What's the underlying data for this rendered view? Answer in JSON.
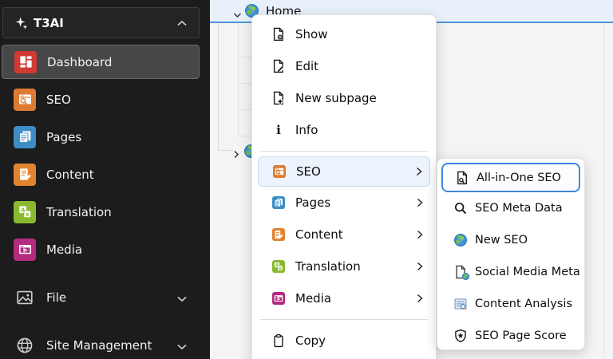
{
  "sidebar": {
    "header": {
      "label": "T3AI",
      "icon": "sparkles-icon",
      "state_icon": "chevron-up-icon"
    },
    "modules": [
      {
        "label": "Dashboard",
        "icon": "dashboard-icon",
        "color": "#d13a34",
        "active": true
      },
      {
        "label": "SEO",
        "icon": "seo-icon",
        "color": "#de7b32",
        "active": false
      },
      {
        "label": "Pages",
        "icon": "pages-icon",
        "color": "#3d8dc6",
        "active": false
      },
      {
        "label": "Content",
        "icon": "content-icon",
        "color": "#e1842f",
        "active": false
      },
      {
        "label": "Translation",
        "icon": "translation-icon",
        "color": "#8ab92f",
        "active": false
      },
      {
        "label": "Media",
        "icon": "media-icon",
        "color": "#b42b80",
        "active": false
      }
    ],
    "sections": [
      {
        "label": "File",
        "icon": "image-icon",
        "state_icon": "chevron-down-icon"
      },
      {
        "label": "Site Management",
        "icon": "globe-outline-icon",
        "state_icon": "chevron-down-icon"
      }
    ]
  },
  "page_tree": {
    "root_node": {
      "label": "Home",
      "icon": "globe-icon",
      "expanded": true,
      "selected": true
    }
  },
  "context_menu": {
    "items_top": [
      {
        "label": "Show",
        "icon": "view-page-icon"
      },
      {
        "label": "Edit",
        "icon": "edit-page-icon"
      },
      {
        "label": "New subpage",
        "icon": "new-page-icon"
      },
      {
        "label": "Info",
        "icon": "info-icon"
      }
    ],
    "module_items": [
      {
        "label": "SEO",
        "icon": "seo-icon",
        "color": "#de7b32",
        "highlighted": true
      },
      {
        "label": "Pages",
        "icon": "pages-icon",
        "color": "#3d8dc6",
        "highlighted": false
      },
      {
        "label": "Content",
        "icon": "content-icon",
        "color": "#e1842f",
        "highlighted": false
      },
      {
        "label": "Translation",
        "icon": "translation-icon",
        "color": "#8ab92f",
        "highlighted": false
      },
      {
        "label": "Media",
        "icon": "media-icon",
        "color": "#b42b80",
        "highlighted": false
      }
    ],
    "items_bottom": [
      {
        "label": "Copy",
        "icon": "clipboard-icon"
      }
    ]
  },
  "submenu": {
    "items": [
      {
        "label": "All-in-One SEO",
        "icon": "page-search-icon",
        "focused": true
      },
      {
        "label": "SEO Meta Data",
        "icon": "magnifier-icon",
        "focused": false
      },
      {
        "label": "New SEO",
        "icon": "globe-icon",
        "focused": false
      },
      {
        "label": "Social Media Meta",
        "icon": "page-globe-icon",
        "focused": false
      },
      {
        "label": "Content Analysis",
        "icon": "doc-analysis-icon",
        "focused": false
      },
      {
        "label": "SEO Page Score",
        "icon": "shield-star-icon",
        "focused": false
      }
    ]
  },
  "colors": {
    "sidebar_bg": "#1c1c1c",
    "sidebar_active_bg": "#474747",
    "tree_bg": "#f4f4f4",
    "tree_selected_bg": "#e8f1fb",
    "accent_blue": "#4f94d8",
    "focus_border": "#3f87dd",
    "highlight_bg": "#ecf3fc"
  }
}
